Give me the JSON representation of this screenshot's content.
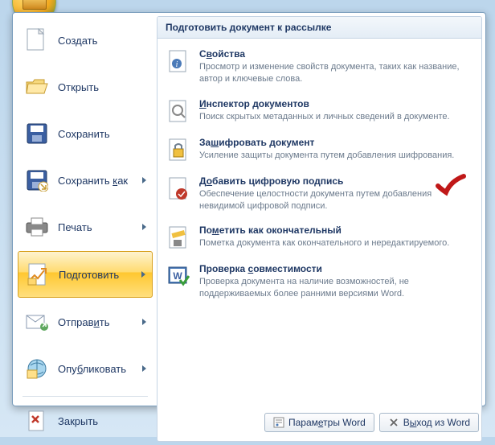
{
  "left": {
    "create": "Создать",
    "open": "Открыть",
    "save": "Сохранить",
    "saveAs": "Сохранить как",
    "print": "Печать",
    "prepare": "Подготовить",
    "send": "Отправить",
    "publish": "Опубликовать",
    "close": "Закрыть"
  },
  "right": {
    "header": "Подготовить документ к рассылке",
    "items": [
      {
        "title": "Свойства",
        "desc": "Просмотр и изменение свойств документа, таких как название, автор и ключевые слова."
      },
      {
        "title": "Инспектор документов",
        "desc": "Поиск скрытых метаданных и личных сведений в документе."
      },
      {
        "title": "Зашифровать документ",
        "desc": "Усиление защиты документа путем добавления шифрования."
      },
      {
        "title": "Добавить цифровую подпись",
        "desc": "Обеспечение целостности документа путем добавления невидимой цифровой подписи."
      },
      {
        "title": "Пометить как окончательный",
        "desc": "Пометка документа как окончательного и нередактируемого."
      },
      {
        "title": "Проверка совместимости",
        "desc": "Проверка документа на наличие возможностей, не поддерживаемых более ранними версиями Word."
      }
    ]
  },
  "footer": {
    "options": "Параметры Word",
    "exit": "Выход из Word"
  }
}
